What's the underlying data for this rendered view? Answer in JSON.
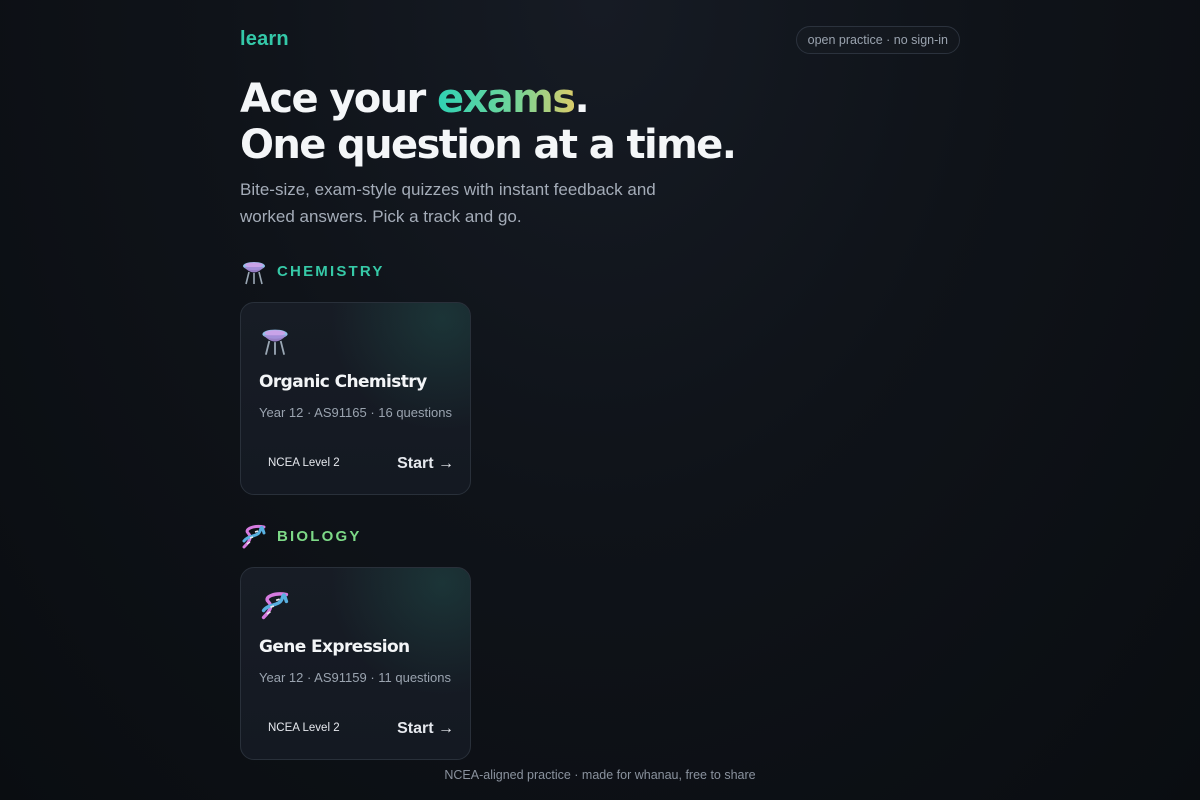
{
  "header": {
    "brand": "learn",
    "pill": "open practice · no sign-in"
  },
  "hero": {
    "line1_prefix": "Ace your ",
    "line1_accent": "exams",
    "line1_suffix": ".",
    "line2": "One question at a time.",
    "subtitle": "Bite-size, exam-style quizzes with instant feedback and worked answers. Pick a track and go."
  },
  "sections": [
    {
      "title": "CHEMISTRY",
      "icon": "flask-icon",
      "accent_color": "#36c9a7",
      "card": {
        "title": "Organic Chemistry",
        "meta": "Year 12 · AS91165 · 16 questions",
        "badge": "NCEA Level 2",
        "action": "Start →"
      }
    },
    {
      "title": "BIOLOGY",
      "icon": "dna-icon",
      "accent_color": "#7dd987",
      "card": {
        "title": "Gene Expression",
        "meta": "Year 12 · AS91159 · 11 questions",
        "badge": "NCEA Level 2",
        "action": "Start →"
      }
    }
  ],
  "footer": {
    "text": "NCEA-aligned practice · made for whanau, free to share"
  },
  "colors": {
    "background": "#0f1319",
    "brand": "#34c8a8",
    "chemistry": "#36c9a7",
    "biology": "#7dd987"
  }
}
